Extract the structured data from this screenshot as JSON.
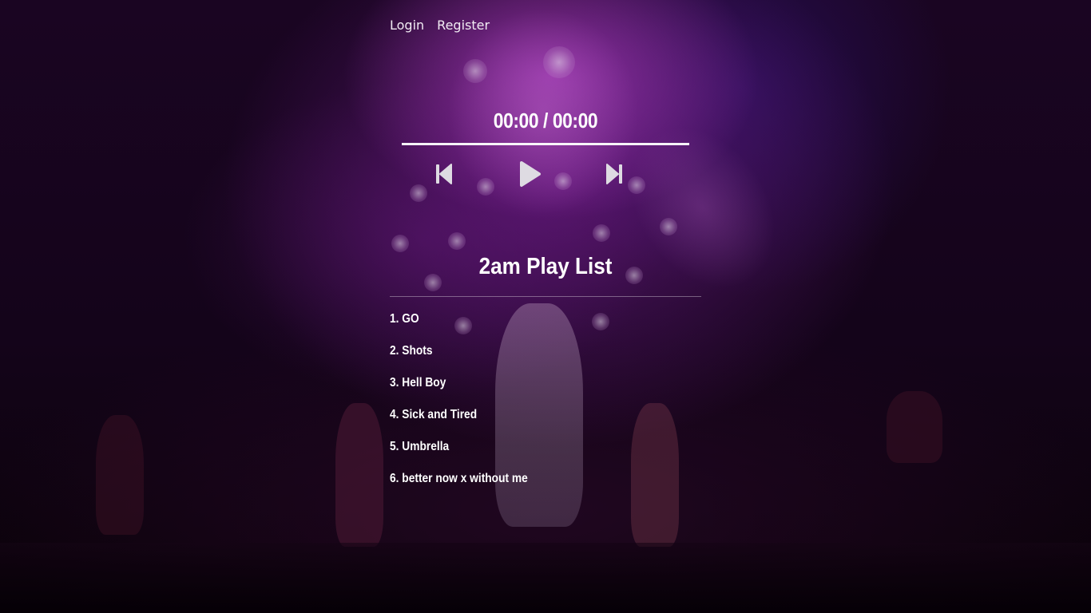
{
  "nav": {
    "login_label": "Login",
    "register_label": "Register"
  },
  "player": {
    "current_time": "00:00",
    "separator": "/",
    "duration": "00:00",
    "time_display": "00:00 / 00:00",
    "progress": 0,
    "controls": {
      "previous_icon": "skip-back-icon",
      "play_icon": "play-icon",
      "next_icon": "skip-forward-icon"
    }
  },
  "playlist": {
    "title": "2am Play List",
    "tracks": [
      "1. GO",
      "2. Shots",
      "3. Hell Boy",
      "4. Sick and Tired",
      "5. Umbrella",
      "6. better now x without me"
    ]
  },
  "colors": {
    "text": "#ffffff",
    "background_dark": "#0a020c",
    "background_accent": "#7a1e96"
  }
}
